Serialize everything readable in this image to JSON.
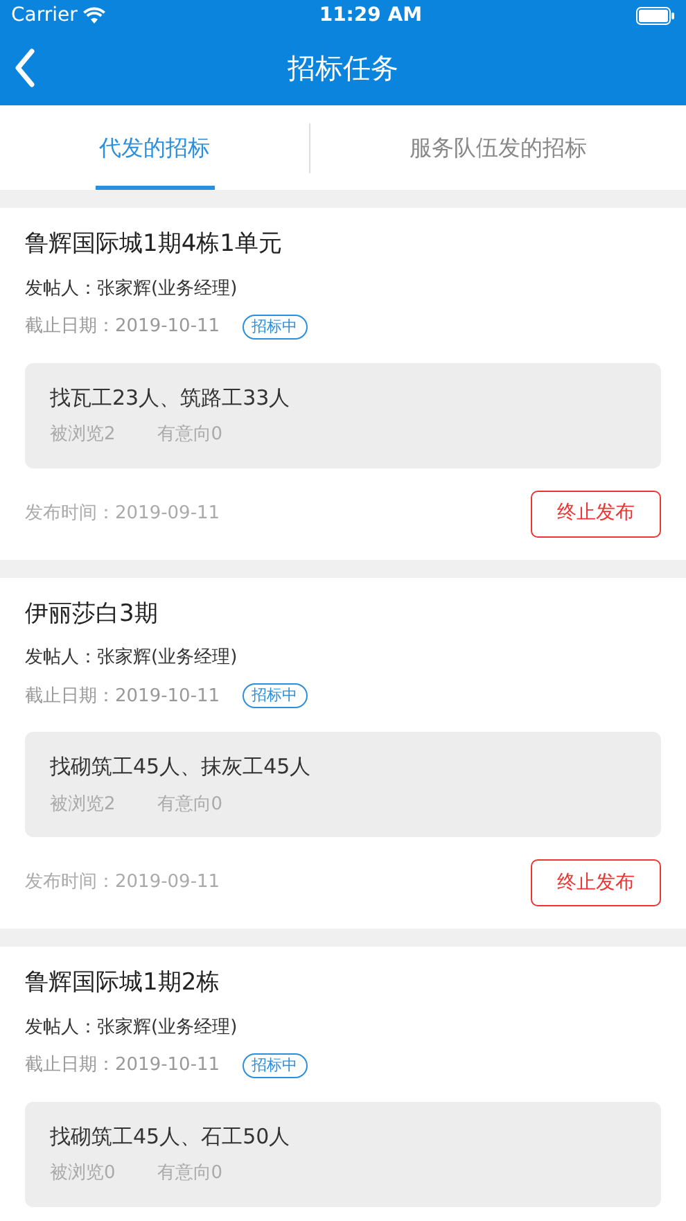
{
  "status_bar": {
    "carrier": "Carrier",
    "time": "11:29 AM"
  },
  "nav": {
    "title": "招标任务"
  },
  "tabs": [
    {
      "label": "代发的招标",
      "selected": true
    },
    {
      "label": "服务队伍发的招标",
      "selected": false
    }
  ],
  "tasks": [
    {
      "title": "鲁辉国际城1期4栋1单元",
      "poster": "发帖人：张家辉(业务经理)",
      "deadline": "截止日期：2019-10-11",
      "status": "招标中",
      "demand": "找瓦工23人、筑路工33人",
      "views": "被浏览2",
      "interest": "有意向0",
      "published": "发布时间：2019-09-11",
      "action": "终止发布"
    },
    {
      "title": "伊丽莎白3期",
      "poster": "发帖人：张家辉(业务经理)",
      "deadline": "截止日期：2019-10-11",
      "status": "招标中",
      "demand": "找砌筑工45人、抹灰工45人",
      "views": "被浏览2",
      "interest": "有意向0",
      "published": "发布时间：2019-09-11",
      "action": "终止发布"
    },
    {
      "title": "鲁辉国际城1期2栋",
      "poster": "发帖人：张家辉(业务经理)",
      "deadline": "截止日期：2019-10-11",
      "status": "招标中",
      "demand": "找砌筑工45人、石工50人",
      "views": "被浏览0",
      "interest": "有意向0"
    }
  ]
}
